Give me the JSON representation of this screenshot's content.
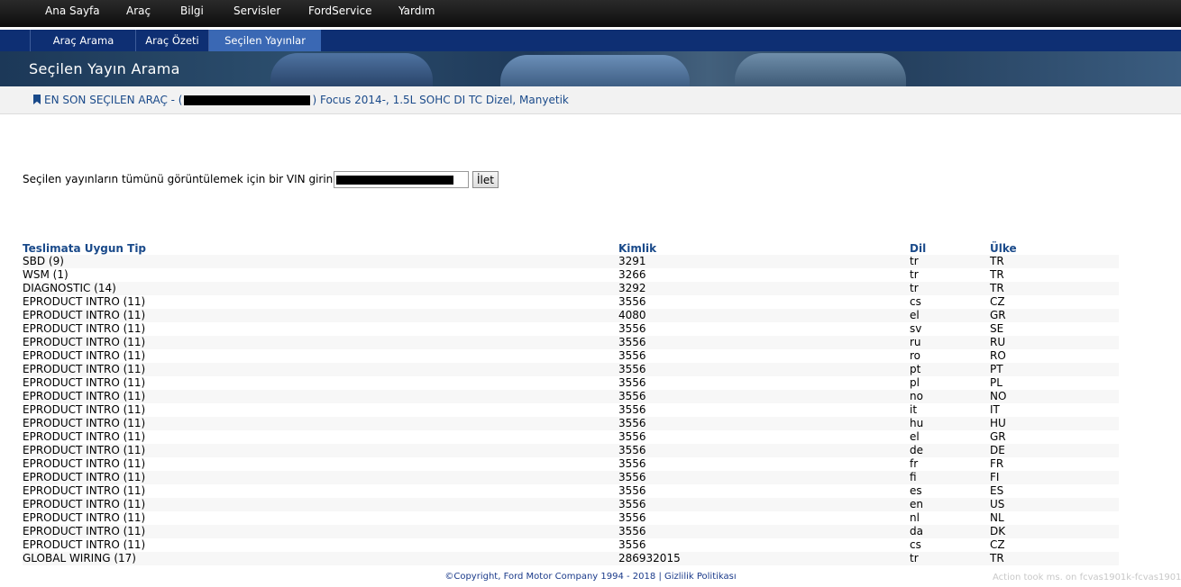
{
  "topnav": [
    "Ana Sayfa",
    "Araç",
    "Bilgi",
    "Servisler",
    "FordService",
    "Yardım"
  ],
  "subnav": {
    "tabs": [
      "Araç Arama",
      "Araç Özeti",
      "Seçilen Yayınlar"
    ],
    "active_index": 2
  },
  "banner": {
    "title": "Seçilen Yayın Arama"
  },
  "vehicle": {
    "prefix": "EN SON SEÇILEN ARAÇ - (",
    "suffix": ") Focus 2014-, 1.5L SOHC DI TC Dizel, Manyetik"
  },
  "vin": {
    "label": "Seçilen yayınların tümünü görüntülemek için bir VIN girin",
    "button": "İlet"
  },
  "table": {
    "headers": [
      "Teslimata Uygun Tip",
      "Kimlik",
      "Dil",
      "Ülke"
    ],
    "rows": [
      [
        "SBD (9)",
        "3291",
        "tr",
        "TR"
      ],
      [
        "WSM (1)",
        "3266",
        "tr",
        "TR"
      ],
      [
        "DIAGNOSTIC (14)",
        "3292",
        "tr",
        "TR"
      ],
      [
        "EPRODUCT INTRO (11)",
        "3556",
        "cs",
        "CZ"
      ],
      [
        "EPRODUCT INTRO (11)",
        "4080",
        "el",
        "GR"
      ],
      [
        "EPRODUCT INTRO (11)",
        "3556",
        "sv",
        "SE"
      ],
      [
        "EPRODUCT INTRO (11)",
        "3556",
        "ru",
        "RU"
      ],
      [
        "EPRODUCT INTRO (11)",
        "3556",
        "ro",
        "RO"
      ],
      [
        "EPRODUCT INTRO (11)",
        "3556",
        "pt",
        "PT"
      ],
      [
        "EPRODUCT INTRO (11)",
        "3556",
        "pl",
        "PL"
      ],
      [
        "EPRODUCT INTRO (11)",
        "3556",
        "no",
        "NO"
      ],
      [
        "EPRODUCT INTRO (11)",
        "3556",
        "it",
        "IT"
      ],
      [
        "EPRODUCT INTRO (11)",
        "3556",
        "hu",
        "HU"
      ],
      [
        "EPRODUCT INTRO (11)",
        "3556",
        "el",
        "GR"
      ],
      [
        "EPRODUCT INTRO (11)",
        "3556",
        "de",
        "DE"
      ],
      [
        "EPRODUCT INTRO (11)",
        "3556",
        "fr",
        "FR"
      ],
      [
        "EPRODUCT INTRO (11)",
        "3556",
        "fi",
        "FI"
      ],
      [
        "EPRODUCT INTRO (11)",
        "3556",
        "es",
        "ES"
      ],
      [
        "EPRODUCT INTRO (11)",
        "3556",
        "en",
        "US"
      ],
      [
        "EPRODUCT INTRO (11)",
        "3556",
        "nl",
        "NL"
      ],
      [
        "EPRODUCT INTRO (11)",
        "3556",
        "da",
        "DK"
      ],
      [
        "EPRODUCT INTRO (11)",
        "3556",
        "cs",
        "CZ"
      ],
      [
        "GLOBAL WIRING (17)",
        "286932015",
        "tr",
        "TR"
      ]
    ]
  },
  "footer": {
    "copyright": "©Copyright, Ford Motor Company 1994 - 2018",
    "separator": "|",
    "privacy": "Gizlilik Politikası",
    "action": "Action took ms. on fcvas1901k-fcvas1901k"
  },
  "colors": {
    "nav_dark": "#0e2f73",
    "active_tab": "#3a68b4",
    "link": "#1a4a8a"
  }
}
